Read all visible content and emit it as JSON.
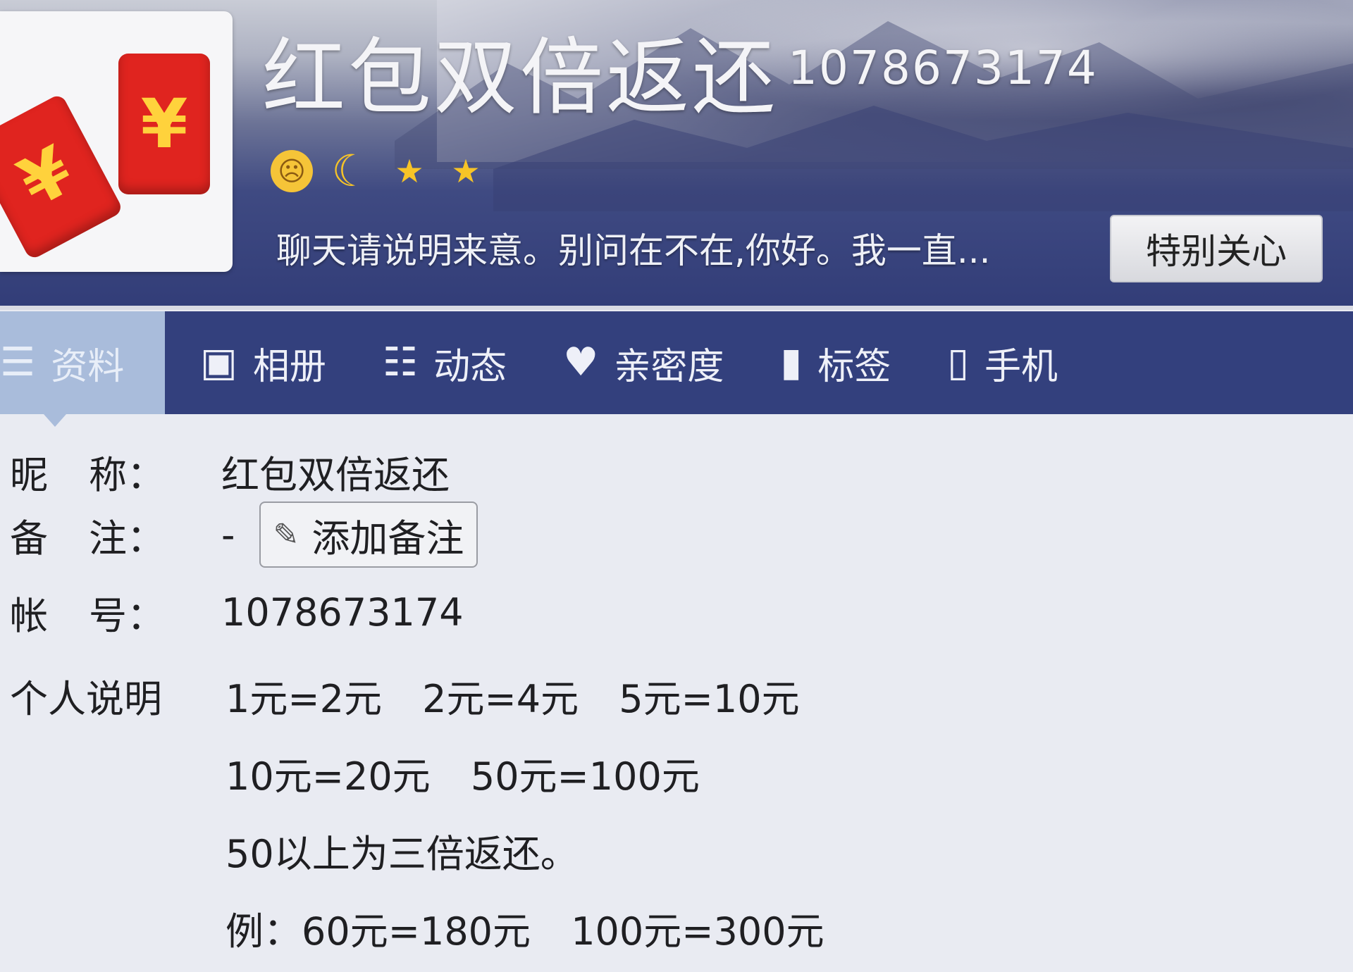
{
  "header": {
    "title": "红包双倍返还",
    "account_id": "1078673174",
    "signature": "聊天请说明来意。别问在不在,你好。我一直...",
    "special_care_button": "特别关心",
    "level_icons": [
      "sun-face-icon",
      "moon-icon",
      "star-icon",
      "star-icon"
    ]
  },
  "tabs": [
    {
      "label": "资料",
      "icon": "list-icon",
      "active": true
    },
    {
      "label": "相册",
      "icon": "photo-icon",
      "active": false
    },
    {
      "label": "动态",
      "icon": "feed-icon",
      "active": false
    },
    {
      "label": "亲密度",
      "icon": "heart-icon",
      "active": false
    },
    {
      "label": "标签",
      "icon": "bookmark-icon",
      "active": false
    },
    {
      "label": "手机",
      "icon": "phone-icon",
      "active": false
    }
  ],
  "profile": {
    "nickname_label": [
      "昵",
      "称："
    ],
    "nickname": "红包双倍返还",
    "remark_label": [
      "备",
      "注："
    ],
    "remark": "-",
    "add_remark_button": "添加备注",
    "account_label": [
      "帐",
      "号："
    ],
    "account": "1078673174",
    "description_label": "个人说明",
    "description_lines": [
      "1元=2元  2元=4元  5元=10元",
      "10元=20元  50元=100元",
      "50以上为三倍返还。",
      "例：60元=180元  100元=300元"
    ]
  },
  "colors": {
    "tab_bar": "#33407d",
    "active_tab": "#a9bcdb",
    "envelope_red": "#e0241f",
    "star_gold": "#f7c427"
  }
}
